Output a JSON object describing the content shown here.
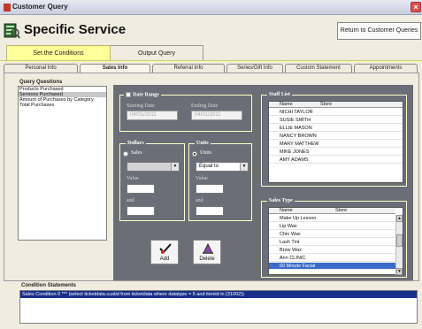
{
  "window": {
    "title": "Customer Query"
  },
  "header": {
    "title": "Specific Service",
    "return_button": "Return to Customer Queries"
  },
  "top_tabs": [
    {
      "label": "Set the Conditions"
    },
    {
      "label": "Output Query"
    }
  ],
  "sub_tabs": [
    {
      "label": "Personal Info"
    },
    {
      "label": "Sales Info"
    },
    {
      "label": "Referral Info"
    },
    {
      "label": "Series/Gift Info"
    },
    {
      "label": "Custom Statement"
    },
    {
      "label": "Appointments"
    }
  ],
  "query_questions": {
    "heading": "Query Questions",
    "items": [
      "Products Purchased",
      "Services Purchased",
      "Amount of Purchases by Category",
      "Total Purchases"
    ]
  },
  "date_range": {
    "label": "Date Range",
    "starting_label": "Starting Date",
    "starting_value": "04/01/2011",
    "ending_label": "Ending Date",
    "ending_value": "04/01/2011"
  },
  "dollars": {
    "legend": "Dollars",
    "radio_label": "Sales",
    "value_label": "Value",
    "and_label": "and"
  },
  "units": {
    "legend": "Units",
    "radio_label": "Units",
    "operator": "Equal to",
    "value_label": "Value",
    "and_label": "and"
  },
  "staff_list": {
    "legend": "Staff List",
    "columns": [
      "Name",
      "Store"
    ],
    "rows": [
      "NICHI TAYLOR",
      "SUSIE SMITH",
      "ELLIE MASON",
      "NANCY BROWN",
      "MARY MATTHEW",
      "MIKE JONES",
      "AMY ADAMS"
    ]
  },
  "sales_type": {
    "legend": "Sales Type",
    "columns": [
      "Name",
      "Store"
    ],
    "rows": [
      "Make Up Lesson",
      "Lip Wax",
      "Chin Wax",
      "Lash Tint",
      "Brow Wax",
      "Ann CLINIC",
      "60 Minute Facial"
    ],
    "selected_row": "60 Minute Facial"
  },
  "buttons": {
    "add": "Add",
    "delete": "Delete"
  },
  "condition_statements": {
    "heading": "Condition Statements",
    "line": "Sales Condition 0 *** (select ticketdata.custid from ticketdata where  datatype = 5  and itemid in  (31002))"
  }
}
